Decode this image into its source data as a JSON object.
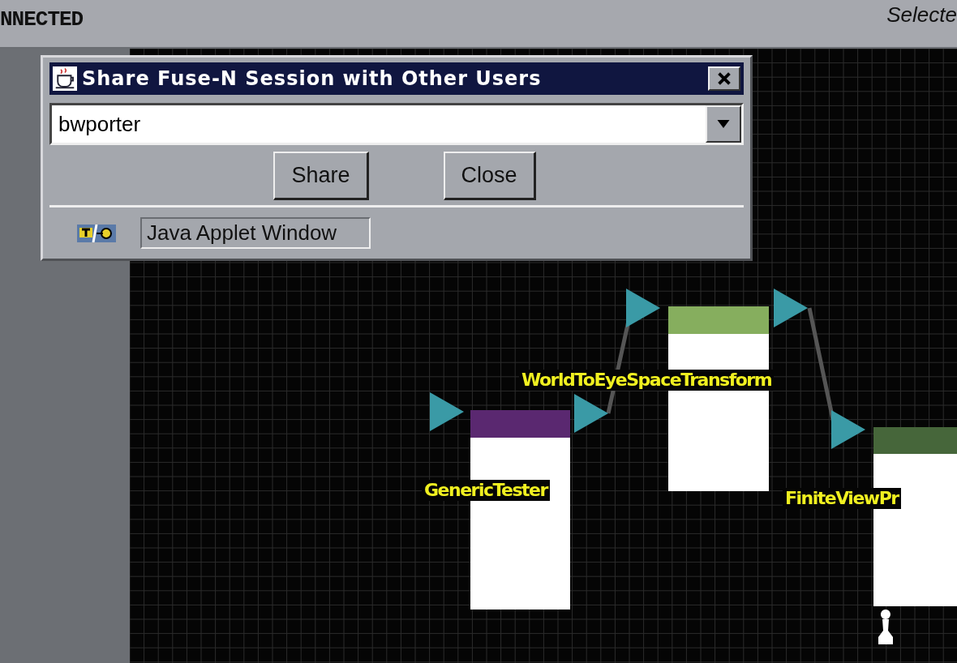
{
  "top_bar": {
    "connection_status": "NNECTED",
    "selection_label": "Selecte"
  },
  "dialog": {
    "title": "Share Fuse-N Session with Other Users",
    "user_field": {
      "value": "bwporter"
    },
    "buttons": [
      "Share",
      "Close"
    ],
    "applet_notice": "Java Applet Window"
  },
  "canvas": {
    "nodes": [
      {
        "label": "GenericTester",
        "color": "#5a2870"
      },
      {
        "label": "WorldToEyeSpaceTransform",
        "color": "#86ae5e"
      },
      {
        "label": "FiniteViewPr",
        "color": "#46663a"
      }
    ]
  }
}
